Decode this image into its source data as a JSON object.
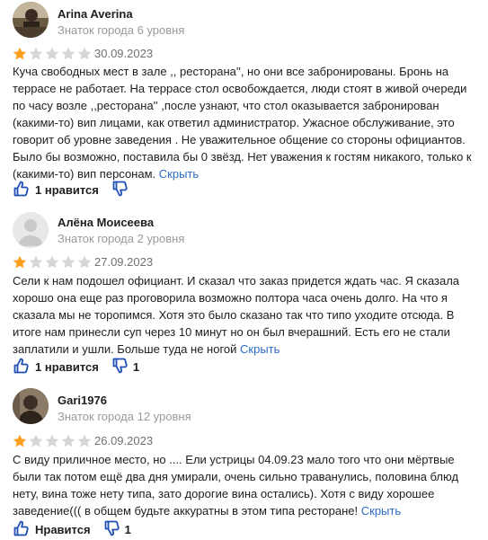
{
  "reviews": [
    {
      "author": "Arina Averina",
      "level": "Знаток города 6 уровня",
      "rating": 1,
      "max_rating": 5,
      "date": "30.09.2023",
      "lines": [
        "Куча свободных мест в зале ,, ресторана'', но они все забронированы. Бронь на",
        "террасе не работает. На террасе стол освобождается, люди стоят в живой очереди",
        "по часу возле ,,ресторана'' ,после узнают, что стол оказывается забронирован",
        "(какими-то) вип лицами, как ответил администратор. Ужасное обслуживание, это",
        "говорит об уровне заведения . Не уважительное общение со стороны официантов.",
        "Было бы возможно, поставила бы 0 звёзд. Нет уважения к гостям никакого, только к",
        "(какими-то) вип персонам."
      ],
      "collapse_label": "Скрыть",
      "like_label": "1 нравится",
      "dislike_count": ""
    },
    {
      "author": "Алёна Моисеева",
      "level": "Знаток города 2 уровня",
      "rating": 1,
      "max_rating": 5,
      "date": "27.09.2023",
      "lines": [
        "Сели к нам подошел официант. И сказал что заказ придется ждать час. Я сказала",
        "хорошо она еще раз проговорила возможно полтора часа очень долго. На что я",
        "сказала мы не торопимся. Хотя это было сказано так что типо уходите отсюда. В",
        "итоге нам принесли суп через 10 минут но он был вчерашний. Есть его не стали",
        "заплатили и ушли. Больше туда не ногой"
      ],
      "collapse_label": "Скрыть",
      "like_label": "1 нравится",
      "dislike_count": "1"
    },
    {
      "author": "Gari1976",
      "level": "Знаток города 12 уровня",
      "rating": 1,
      "max_rating": 5,
      "date": "26.09.2023",
      "lines": [
        "С виду приличное место, но .... Ели устрицы 04.09.23 мало того что они мёртвые",
        "были так потом ещё два дня умирали, очень сильно траванулись, половина блюд",
        "нету, вина тоже нету типа, зато дорогие вина остались). Хотя с виду хорошее",
        "заведение((( в общем будьте аккуратны в этом типа ресторане!"
      ],
      "collapse_label": "Скрыть",
      "like_label": "Нравится",
      "dislike_count": "1"
    }
  ],
  "colors": {
    "star_filled": "#fc9f1d",
    "star_empty": "#d6d6d6",
    "link": "#2c6cc4",
    "action_icon": "#1e4fb5"
  }
}
